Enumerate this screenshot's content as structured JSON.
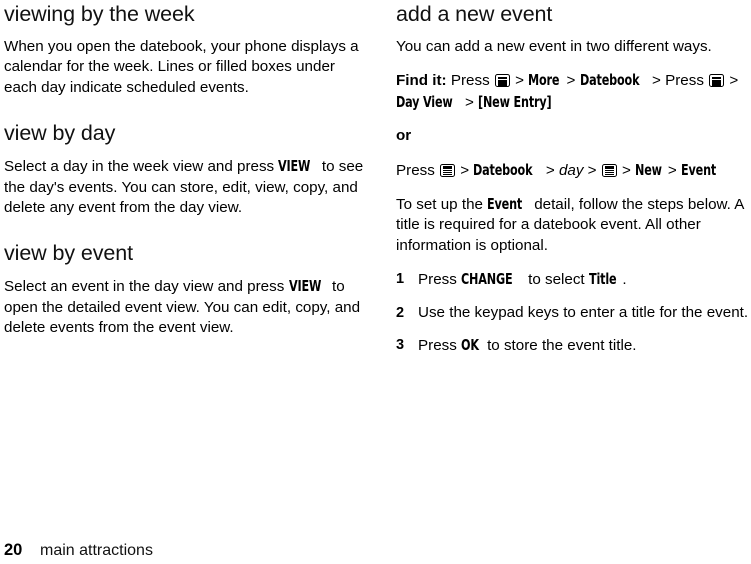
{
  "page": {
    "number": "20",
    "chapter": "main attractions"
  },
  "icons": {
    "menu_key": "menu-key-icon"
  },
  "left_column": {
    "sections": [
      {
        "heading": "viewing by the week",
        "paragraph": "When you open the datebook, your phone displays a calendar for the week. Lines or filled boxes under each day indicate scheduled events."
      },
      {
        "heading": "view by day",
        "para_pre": "Select a day in the week view and press ",
        "key1": "VIEW",
        "para_post": " to see the day's events. You can store, edit, view, copy, and delete any event from the day view."
      },
      {
        "heading": "view by event",
        "para_pre": "Select an event in the day view and press ",
        "key1": "VIEW",
        "para_post": " to open the detailed event view. You can edit, copy, and delete events from the event view."
      }
    ]
  },
  "right_column": {
    "heading": "add a new event",
    "intro": "You can add a new event in two different ways.",
    "find_it": {
      "label": "Find it:",
      "press1": "Press",
      "sep": ">",
      "item_more": "More",
      "item_datebook": "Datebook",
      "press2": "Press",
      "item_day_view": "Day View",
      "item_new_entry": "[New Entry]"
    },
    "or_label": "or",
    "alt_path": {
      "press": "Press",
      "sep": ">",
      "item_datebook": "Datebook",
      "item_day": "day",
      "item_new": "New",
      "item_event": "Event"
    },
    "setup_pre": "To set up the ",
    "setup_key": "Event",
    "setup_post": " detail, follow the steps below. A title is required for a datebook event. All other information is optional.",
    "steps": [
      {
        "num": "1",
        "pre": "Press ",
        "key1": "CHANGE",
        "mid": " to select ",
        "key2": "Title",
        "post": "."
      },
      {
        "num": "2",
        "pre": "Use the keypad keys to enter a title for the event.",
        "key1": "",
        "mid": "",
        "key2": "",
        "post": ""
      },
      {
        "num": "3",
        "pre": "Press ",
        "key1": "OK",
        "mid": " to store the event title.",
        "key2": "",
        "post": ""
      }
    ]
  }
}
